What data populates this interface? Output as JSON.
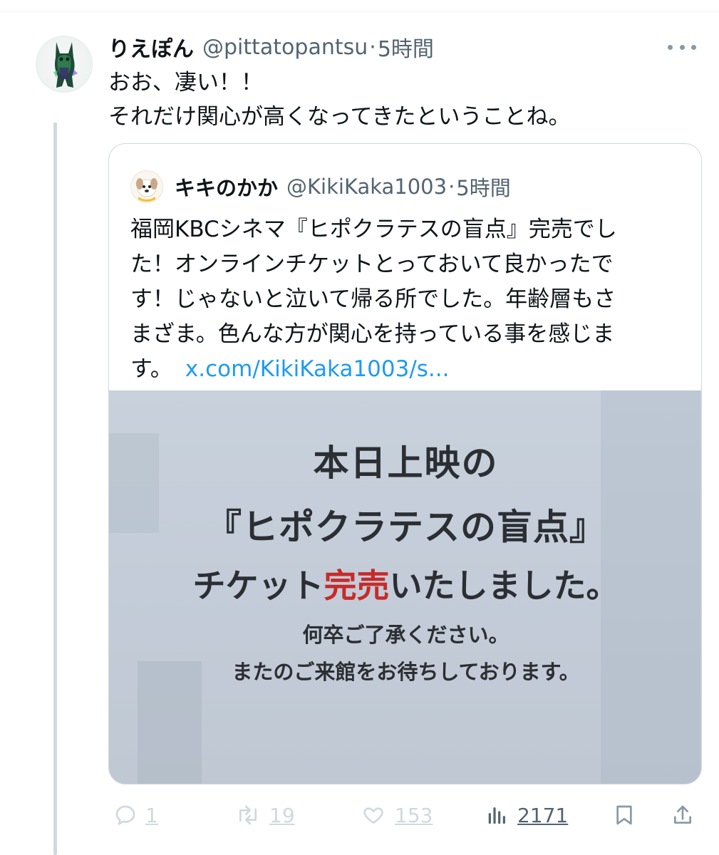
{
  "tweet": {
    "display_name": "りえぽん",
    "handle": "@pittatopantsu",
    "separator": "·",
    "time": "5時間",
    "text_lines": [
      "おお、凄い！！",
      "それだけ関心が高くなってきたということね。"
    ]
  },
  "quote": {
    "display_name": "キキのかか",
    "handle": "@KikiKaka1003",
    "separator": "·",
    "time": "5時間",
    "text_lines": [
      "福岡KBCシネマ『ヒポクラテスの盲点』完売でし",
      "た！オンラインチケットとっておいて良かったで",
      "す！じゃないと泣いて帰る所でした。年齢層もさ",
      "まざま。色んな方が関心を持っている事を感じま",
      "す。"
    ],
    "link": "x.com/KikiKaka1003/s...",
    "image_sign": {
      "line1": "本日上映の",
      "line2": "『ヒポクラテスの盲点』",
      "line3_before": "チケット",
      "line3_red": "完売",
      "line3_after": "いたしました。",
      "line4": "何卒ご了承ください。",
      "line5": "またのご来館をお待ちしております。"
    }
  },
  "actions": {
    "replies": "1",
    "retweets": "19",
    "likes": "153",
    "views": "2171"
  },
  "colors": {
    "accent_link": "#1d9bf0",
    "secondary_text": "#536471",
    "sold_out_red": "#c72a2a"
  }
}
